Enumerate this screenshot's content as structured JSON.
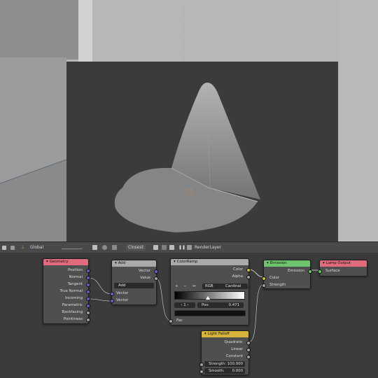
{
  "header": {
    "orientation": "Global",
    "snap": "Closest",
    "layer": "RenderLayer"
  },
  "nodes": {
    "geometry": {
      "title": "Geometry",
      "color": "#e06b7c",
      "outputs": [
        "Position",
        "Normal",
        "Tangent",
        "True Normal",
        "Incoming",
        "Parametric",
        "Backfacing",
        "Pointiness"
      ]
    },
    "add": {
      "title": "Add",
      "color": "#a9a9a9",
      "outputs": [
        "Vector",
        "Value"
      ],
      "operation": "Add",
      "inputs": [
        "Vector",
        "Vector"
      ]
    },
    "colorramp": {
      "title": "ColorRamp",
      "color": "#a9a9a9",
      "outputs": [
        "Color",
        "Alpha"
      ],
      "mode": "RGB",
      "interpolation": "Cardinal",
      "stop_index": "1",
      "pos_label": "Pos:",
      "pos_value": "0.471",
      "input": "Fac",
      "plus": "+",
      "minus": "−",
      "flip": "↔"
    },
    "emission": {
      "title": "Emission",
      "color": "#6fc56f",
      "output": "Emission",
      "inputs": [
        "Color",
        "Strength"
      ]
    },
    "lampoutput": {
      "title": "Lamp Output",
      "color": "#e06b7c",
      "input": "Surface"
    },
    "lightfalloff": {
      "title": "Light Falloff",
      "color": "#d6b33a",
      "outputs": [
        "Quadratic",
        "Linear",
        "Constant"
      ],
      "strength_label": "Strength:",
      "strength_value": "100.000",
      "smooth_label": "Smooth:",
      "smooth_value": "0.000"
    }
  },
  "colors": {
    "vector_socket": "#6363c7",
    "color_socket": "#c7c729",
    "value_socket": "#a1a1a1",
    "shader_socket": "#63c763",
    "selected_link": "#e8e8e8"
  }
}
